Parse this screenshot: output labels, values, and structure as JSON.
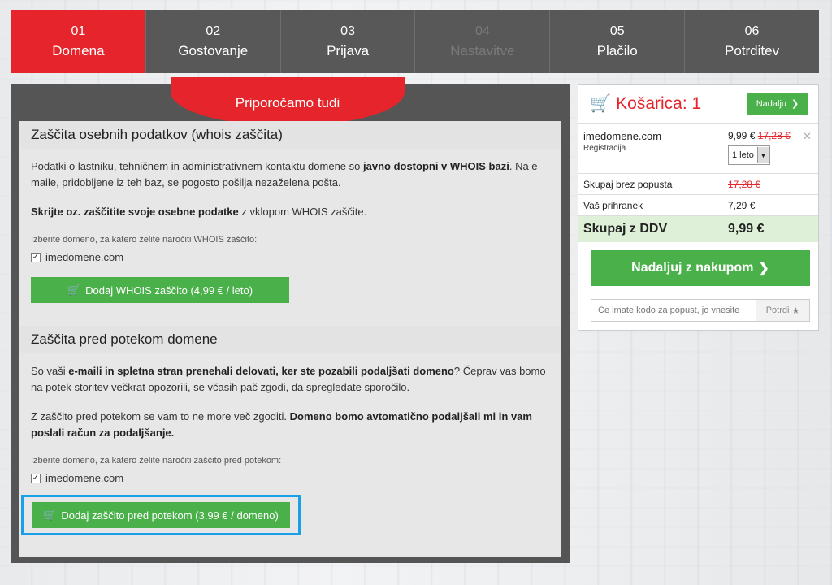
{
  "steps": [
    {
      "num": "01",
      "label": "Domena"
    },
    {
      "num": "02",
      "label": "Gostovanje"
    },
    {
      "num": "03",
      "label": "Prijava"
    },
    {
      "num": "04",
      "label": "Nastavitve"
    },
    {
      "num": "05",
      "label": "Plačilo"
    },
    {
      "num": "06",
      "label": "Potrditev"
    }
  ],
  "left": {
    "recommend_title": "Priporočamo tudi",
    "whois": {
      "title": "Zaščita osebnih podatkov (whois zaščita)",
      "p1_a": "Podatki o lastniku, tehničnem in administrativnem kontaktu domene so ",
      "p1_b": "javno dostopni v WHOIS bazi",
      "p1_c": ". Na e-maile, pridobljene iz teh baz, se pogosto pošilja nezaželena pošta.",
      "p2_a": "Skrijte oz. zaščitite svoje osebne podatke",
      "p2_b": " z vklopom WHOIS zaščite.",
      "select_label": "Izberite domeno, za katero želite naročiti WHOIS zaščito:",
      "domain": "imedomene.com",
      "button": "Dodaj WHOIS zaščito (4,99 € / leto)"
    },
    "expiry": {
      "title": "Zaščita pred potekom domene",
      "p1_a": "So vaši ",
      "p1_b": "e-maili in spletna stran prenehali delovati, ker ste pozabili podaljšati domeno",
      "p1_c": "? Čeprav vas bomo na potek storitev večkrat opozorili, se včasih pač zgodi, da spregledate sporočilo.",
      "p2_a": "Z zaščito pred potekom se vam to ne more več zgoditi. ",
      "p2_b": "Domeno bomo avtomatično podaljšali mi in vam poslali račun za podaljšanje.",
      "select_label": "Izberite domeno, za katero želite naročiti zaščito pred potekom:",
      "domain": "imedomene.com",
      "button": "Dodaj zaščito pred potekom (3,99 € / domeno)"
    }
  },
  "cart": {
    "title": "Košarica: 1",
    "next_small": "Nadalju",
    "item": {
      "name": "imedomene.com",
      "type": "Registracija",
      "price": "9,99 €",
      "old_price": "17,28 €",
      "period": "1 leto"
    },
    "subtotal_label": "Skupaj brez popusta",
    "subtotal_value": "17,28 €",
    "savings_label": "Vaš prihranek",
    "savings_value": "7,29 €",
    "total_label": "Skupaj z DDV",
    "total_value": "9,99 €",
    "continue_button": "Nadaljuj z nakupom",
    "promo_placeholder": "Če imate kodo za popust, jo vnesite",
    "promo_button": "Potrdi"
  },
  "colors": {
    "accent_red": "#e5252b",
    "green": "#4ab04a",
    "highlight": "#1aa0e6"
  }
}
